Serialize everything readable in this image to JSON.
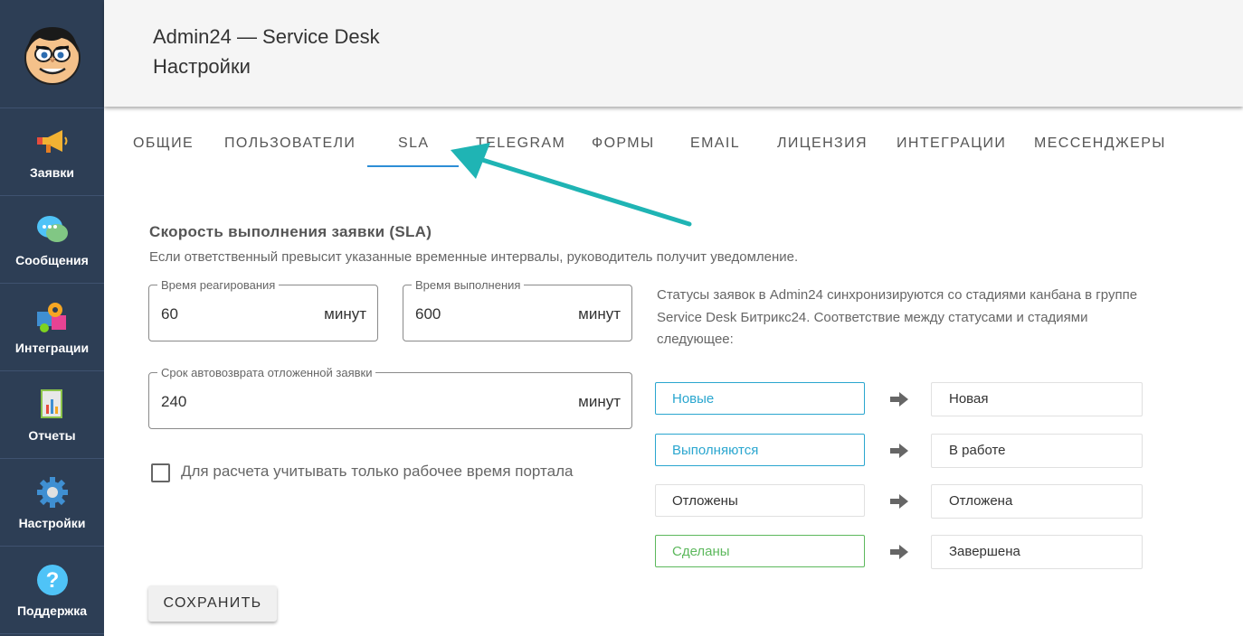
{
  "header": {
    "app_title": "Admin24 — Service Desk",
    "page_title": "Настройки"
  },
  "sidebar": {
    "items": [
      {
        "label": "Заявки",
        "icon": "megaphone-icon"
      },
      {
        "label": "Сообщения",
        "icon": "chat-bubbles-icon"
      },
      {
        "label": "Интеграции",
        "icon": "puzzle-gear-icon"
      },
      {
        "label": "Отчеты",
        "icon": "report-icon"
      },
      {
        "label": "Настройки",
        "icon": "gear-icon"
      },
      {
        "label": "Поддержка",
        "icon": "help-icon"
      }
    ]
  },
  "tabs": [
    {
      "label": "ОБЩИЕ"
    },
    {
      "label": "ПОЛЬЗОВАТЕЛИ"
    },
    {
      "label": "SLA",
      "active": true
    },
    {
      "label": "TELEGRAM"
    },
    {
      "label": "ФОРМЫ"
    },
    {
      "label": "EMAIL"
    },
    {
      "label": "ЛИЦЕНЗИЯ"
    },
    {
      "label": "ИНТЕГРАЦИИ"
    },
    {
      "label": "МЕССЕНДЖЕРЫ"
    }
  ],
  "sla": {
    "title": "Скорость выполнения заявки (SLA)",
    "description": "Если ответственный превысит указанные временные интервалы, руководитель получит уведомление.",
    "reaction": {
      "label": "Время реагирования",
      "value": "60",
      "unit": "минут"
    },
    "execution": {
      "label": "Время выполнения",
      "value": "600",
      "unit": "минут"
    },
    "autoreturn": {
      "label": "Срок автовозврата отложенной заявки",
      "value": "240",
      "unit": "минут"
    },
    "workhours_checkbox": {
      "label": "Для расчета учитывать только рабочее время портала",
      "checked": false
    },
    "save_label": "СОХРАНИТЬ"
  },
  "statuses": {
    "info": "Статусы заявок в Admin24 синхронизируются со стадиями канбана в группе Service Desk Битрикс24. Соответствие между статусами и стадиями следующее:",
    "rows": [
      {
        "status": "Новые",
        "stage": "Новая",
        "color": "#2aa6cf"
      },
      {
        "status": "Выполняются",
        "stage": "В работе",
        "color": "#2aa6cf"
      },
      {
        "status": "Отложены",
        "stage": "Отложена",
        "color": "#333333"
      },
      {
        "status": "Сделаны",
        "stage": "Завершена",
        "color": "#5cb85c"
      }
    ]
  },
  "colors": {
    "sidebar_bg": "#2d3e55",
    "accent": "#2d8ed6",
    "annotation_arrow": "#1fb4b4"
  }
}
